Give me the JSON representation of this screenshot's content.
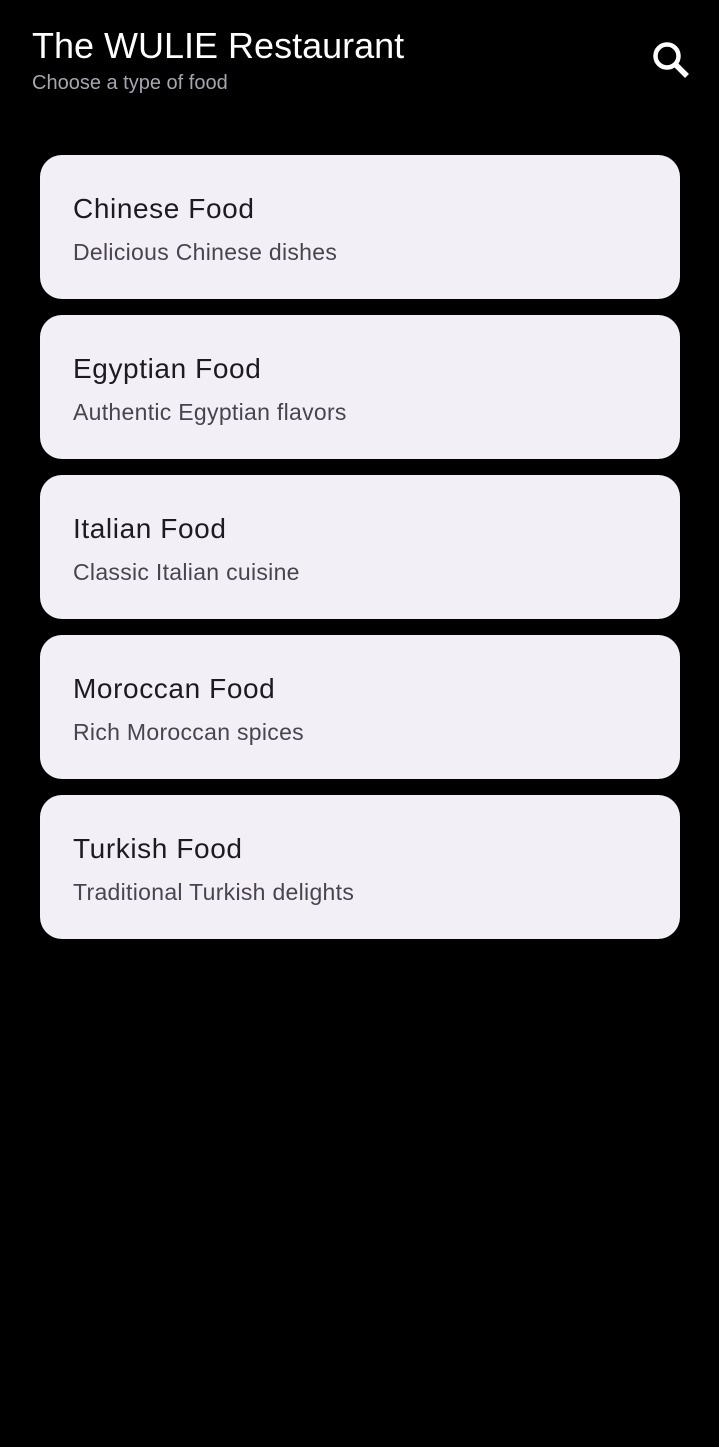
{
  "app_bar": {
    "title": "The WULIE Restaurant",
    "subtitle": "Choose a type of food",
    "search_icon": "search-icon"
  },
  "food_types": [
    {
      "title": "Chinese Food",
      "description": "Delicious Chinese dishes"
    },
    {
      "title": "Egyptian Food",
      "description": "Authentic Egyptian flavors"
    },
    {
      "title": "Italian Food",
      "description": "Classic Italian cuisine"
    },
    {
      "title": "Moroccan Food",
      "description": "Rich Moroccan spices"
    },
    {
      "title": "Turkish Food",
      "description": "Traditional Turkish delights"
    }
  ],
  "colors": {
    "background": "#000000",
    "card": "#f2eff6",
    "title_text": "#ffffff",
    "subtitle_text": "#a6a6ad",
    "card_title": "#1c1b1f",
    "card_description": "#49454f"
  }
}
